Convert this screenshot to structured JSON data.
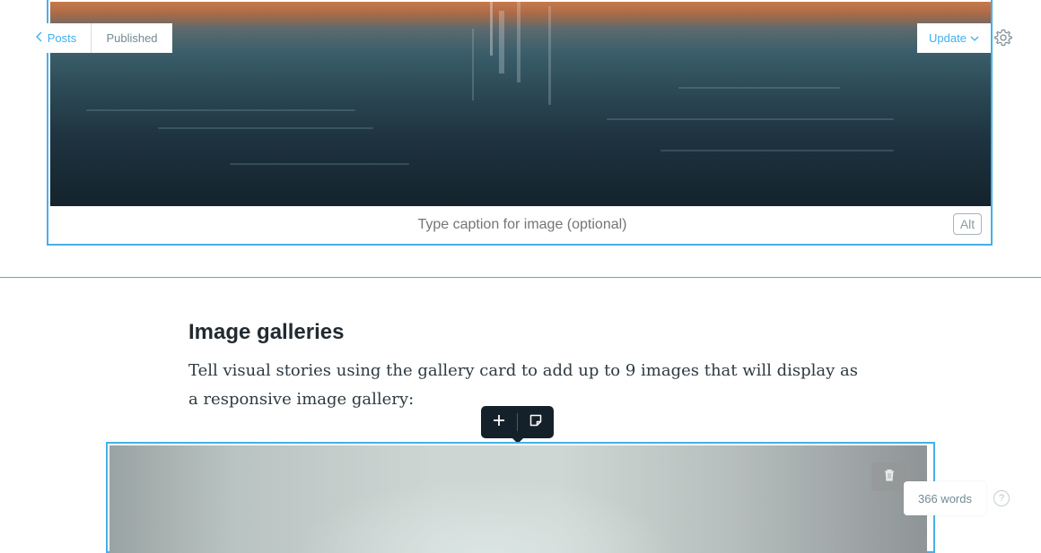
{
  "toolbar": {
    "back_label": "Posts",
    "status_label": "Published",
    "update_label": "Update"
  },
  "image_card": {
    "caption_placeholder": "Type caption for image (optional)",
    "alt_label": "Alt"
  },
  "content": {
    "heading": "Image galleries",
    "paragraph": "Tell visual stories using the gallery card to add up to 9 images that will display as a responsive image gallery:"
  },
  "footer": {
    "word_count": "366 words",
    "help_label": "?"
  },
  "colors": {
    "accent": "#3eb0ef",
    "selection_border": "#47b0ea",
    "toolbar_bg": "#15212a"
  },
  "icons": [
    "chevron-left-icon",
    "chevron-down-icon",
    "gear-icon",
    "plus-icon",
    "snippet-icon",
    "trash-icon",
    "help-icon"
  ]
}
